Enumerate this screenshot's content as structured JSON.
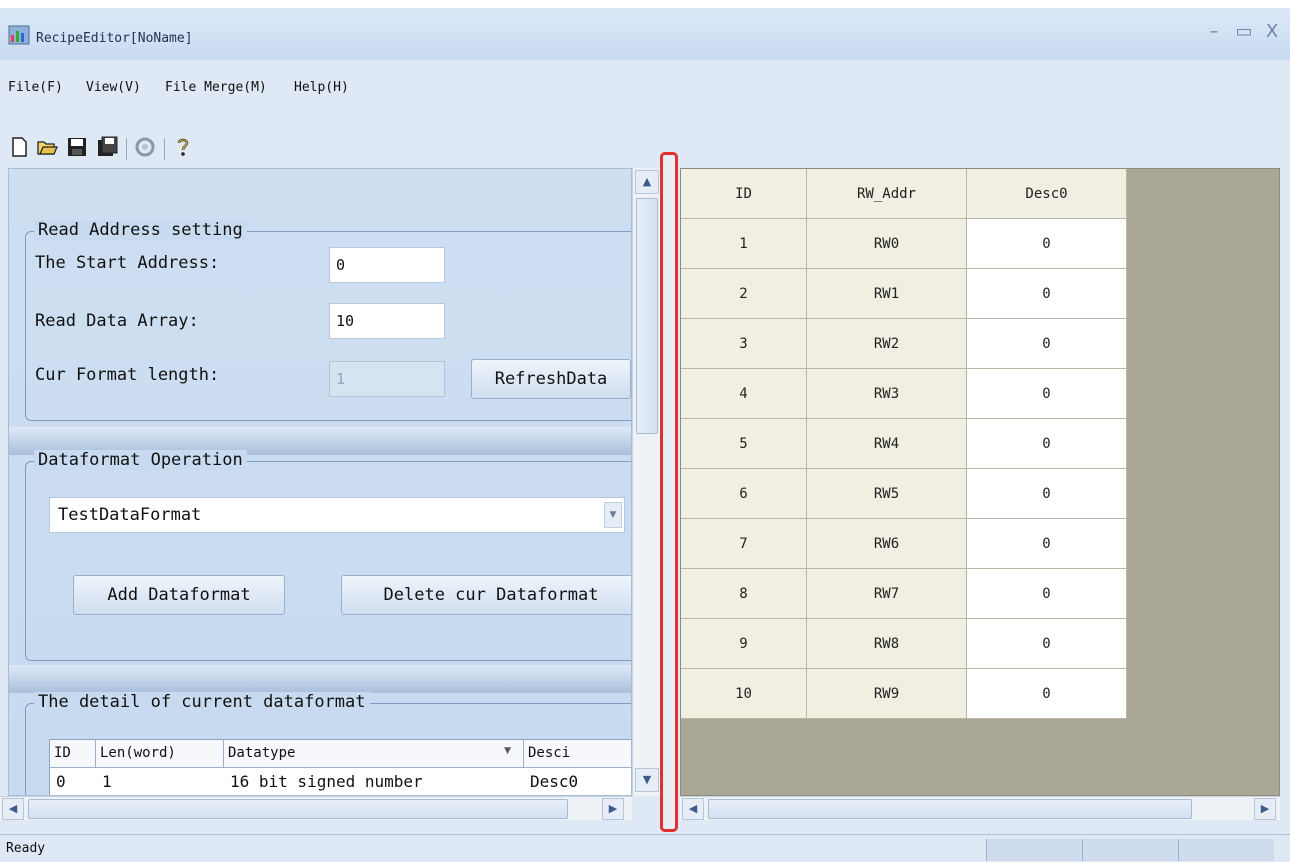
{
  "window": {
    "title": "RecipeEditor[NoName]",
    "minimize": "–",
    "maximize": "▭",
    "close": "X"
  },
  "menu": [
    {
      "label": "File(F)"
    },
    {
      "label": "View(V)"
    },
    {
      "label": "File Merge(M)"
    },
    {
      "label": "Help(H)"
    }
  ],
  "toolbar": {
    "icons": [
      "new-file-icon",
      "open-folder-icon",
      "save-icon",
      "save-as-icon",
      "refresh-icon",
      "help-icon"
    ]
  },
  "read_address": {
    "title": "Read Address setting",
    "start_label": "The Start Address:",
    "start_value": "0",
    "array_label": "Read Data Array:",
    "array_value": "10",
    "format_label": "Cur Format length:",
    "format_value": "1",
    "refresh_button": "RefreshData"
  },
  "dataformat_op": {
    "title": "Dataformat Operation",
    "selected": "TestDataFormat",
    "add_button": "Add Dataformat",
    "delete_button": "Delete cur Dataformat"
  },
  "detail": {
    "title": "The detail of current dataformat",
    "columns": [
      "ID",
      "Len(word)",
      "Datatype",
      "Desci"
    ],
    "row": [
      "0",
      "1",
      "16 bit signed number",
      "Desc0"
    ]
  },
  "grid": {
    "columns": [
      "ID",
      "RW_Addr",
      "Desc0"
    ],
    "rows": [
      [
        "1",
        "RW0",
        "0"
      ],
      [
        "2",
        "RW1",
        "0"
      ],
      [
        "3",
        "RW2",
        "0"
      ],
      [
        "4",
        "RW3",
        "0"
      ],
      [
        "5",
        "RW4",
        "0"
      ],
      [
        "6",
        "RW5",
        "0"
      ],
      [
        "7",
        "RW6",
        "0"
      ],
      [
        "8",
        "RW7",
        "0"
      ],
      [
        "9",
        "RW8",
        "0"
      ],
      [
        "10",
        "RW9",
        "0"
      ]
    ]
  },
  "status": {
    "text": "Ready"
  },
  "colors": {
    "highlight": "#e03030",
    "grid_background": "#aba796",
    "window_background": "#dfe9f6"
  }
}
